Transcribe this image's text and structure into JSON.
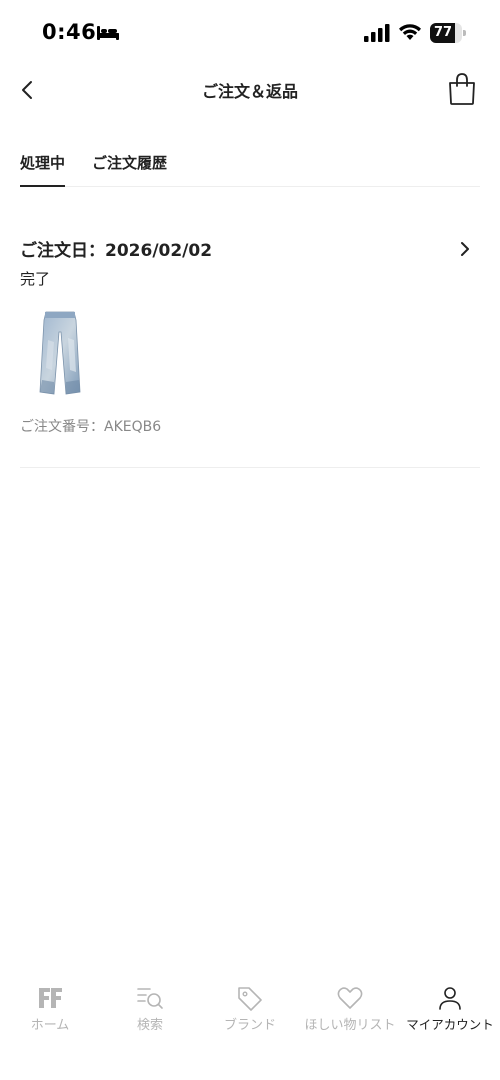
{
  "status_bar": {
    "time": "0:46",
    "battery": "77",
    "battery_level": 0.77
  },
  "header": {
    "title": "ご注文＆返品",
    "back_icon": "chevron-left-icon",
    "bag_icon": "shopping-bag-icon"
  },
  "tabs": [
    {
      "label": "処理中",
      "active": true
    },
    {
      "label": "ご注文履歴",
      "active": false
    }
  ],
  "order": {
    "date_label": "ご注文日：2026/02/02",
    "status": "完了",
    "product_image": "jeans-image",
    "order_number": "ご注文番号：AKEQB6"
  },
  "bottom_nav": [
    {
      "label": "ホーム",
      "icon": "ff-logo-icon",
      "active": false
    },
    {
      "label": "検索",
      "icon": "search-list-icon",
      "active": false
    },
    {
      "label": "ブランド",
      "icon": "tag-icon",
      "active": false
    },
    {
      "label": "ほしい物リスト",
      "icon": "heart-icon",
      "active": false
    },
    {
      "label": "マイアカウント",
      "icon": "person-icon",
      "active": true
    }
  ],
  "colors": {
    "text": "#222222",
    "muted": "#888888",
    "nav_inactive": "#b5b5b5",
    "divider": "#eeeeee"
  }
}
